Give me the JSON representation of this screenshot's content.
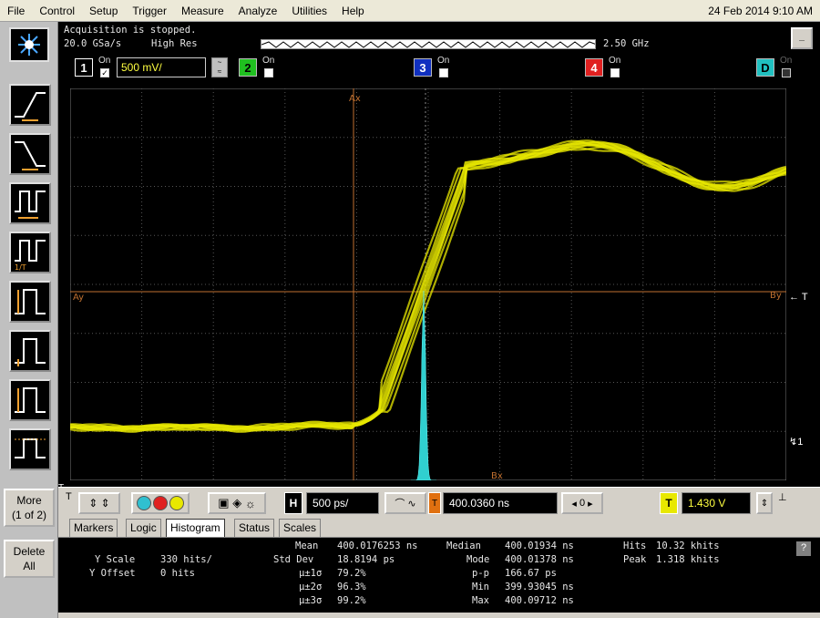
{
  "menu": [
    "File",
    "Control",
    "Setup",
    "Trigger",
    "Measure",
    "Analyze",
    "Utilities",
    "Help"
  ],
  "datetime": "24 Feb 2014  9:10 AM",
  "acquisition": {
    "status": "Acquisition is stopped.",
    "sample_rate": "20.0 GSa/s",
    "mode": "High Res",
    "bandwidth": "2.50 GHz",
    "minimize_label": "_"
  },
  "channels": [
    {
      "num": "1",
      "on_label": "On",
      "checked": "✓",
      "scale": "500 mV/",
      "color": "#e8e800",
      "text_color": "#000"
    },
    {
      "num": "2",
      "on_label": "On",
      "color": "#20c020",
      "text_color": "#000"
    },
    {
      "num": "3",
      "on_label": "On",
      "color": "#1030c0",
      "text_color": "#fff"
    },
    {
      "num": "4",
      "on_label": "On",
      "color": "#e02020",
      "text_color": "#fff"
    },
    {
      "num": "D",
      "on_label": "On",
      "color": "#20c0c0",
      "text_color": "#000"
    }
  ],
  "sidebar": {
    "more_label": "More",
    "more_sub": "(1 of 2)",
    "delete_label": "Delete",
    "delete_sub": "All"
  },
  "markers": {
    "ax": "Ax",
    "ay": "Ay",
    "bx": "Bx",
    "by": "By",
    "trigger": "T",
    "ref_right": "← T",
    "gnd": "↯1"
  },
  "timebase": {
    "h_label": "H",
    "scale": "500 ps/",
    "delay": "400.0360 ns",
    "t_label": "T",
    "trigger_level": "1.430 V",
    "slope_label": "⊥",
    "nav_left": "◂",
    "nav_center": "0",
    "nav_right": "▸"
  },
  "tabs": [
    "Markers",
    "Logic",
    "Histogram",
    "Status",
    "Scales"
  ],
  "active_tab": "Histogram",
  "histogram": {
    "y_scale_label": "Y Scale",
    "y_scale_value": "330 hits/",
    "y_offset_label": "Y Offset",
    "y_offset_value": "0 hits",
    "mean_label": "Mean",
    "mean_value": "400.0176253 ns",
    "stddev_label": "Std Dev",
    "stddev_value": "18.8194 ps",
    "s1_label": "µ±1σ",
    "s1_value": "79.2%",
    "s2_label": "µ±2σ",
    "s2_value": "96.3%",
    "s3_label": "µ±3σ",
    "s3_value": "99.2%",
    "median_label": "Median",
    "median_value": "400.01934 ns",
    "mode_label": "Mode",
    "mode_value": "400.01378 ns",
    "pp_label": "p-p",
    "pp_value": "166.67 ps",
    "min_label": "Min",
    "min_value": "399.93045 ns",
    "max_label": "Max",
    "max_value": "400.09712 ns",
    "hits_label": "Hits",
    "hits_value": "10.32 khits",
    "peak_label": "Peak",
    "peak_value": "1.318 khits",
    "help_label": "?"
  },
  "colors": {
    "trace": "#e8e800",
    "histogram": "#30d0d0",
    "marker": "#c07030",
    "grid": "#555555"
  }
}
